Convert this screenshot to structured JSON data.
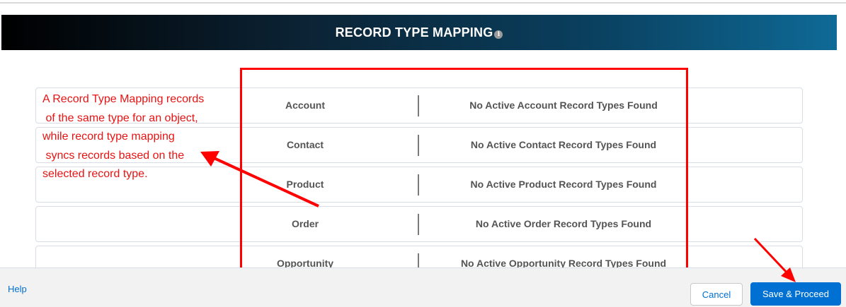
{
  "header": {
    "title": "RECORD TYPE MAPPING",
    "info_icon": "info-icon"
  },
  "mapping_rows": [
    {
      "object": "Account",
      "status": "No Active Account Record Types Found"
    },
    {
      "object": "Contact",
      "status": "No Active Contact Record Types Found"
    },
    {
      "object": "Product",
      "status": "No Active Product Record Types Found"
    },
    {
      "object": "Order",
      "status": "No Active Order Record Types Found"
    },
    {
      "object": "Opportunity",
      "status": "No Active Opportunity Record Types Found"
    }
  ],
  "annotation": {
    "text": "A Record Type Mapping records\n of the same type for an object,\nwhile record type mapping\n syncs records based on the\nselected record type."
  },
  "footer": {
    "help_label": "Help",
    "cancel_label": "Cancel",
    "save_label": "Save & Proceed"
  },
  "colors": {
    "accent": "#0070d2",
    "annotation_red": "#ff0000",
    "banner_start": "#000000",
    "banner_end": "#0e6a96"
  }
}
